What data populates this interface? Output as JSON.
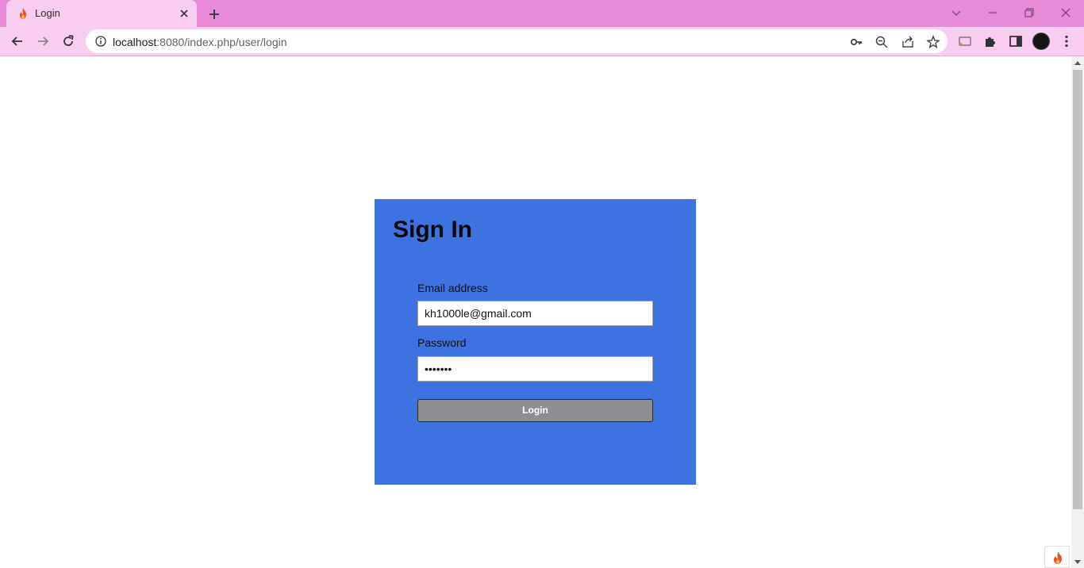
{
  "browser": {
    "tab_title": "Login",
    "url_host": "localhost",
    "url_rest": ":8080/index.php/user/login",
    "accent_color": "#e98ad6"
  },
  "icons": {
    "favicon": "flame-icon",
    "tab_close": "close-icon",
    "new_tab": "plus-icon",
    "back": "arrow-left-icon",
    "forward": "arrow-right-icon",
    "reload": "reload-icon",
    "site_info": "info-icon",
    "key": "key-icon",
    "zoom": "zoom-out-icon",
    "share": "share-icon",
    "bookmark": "star-icon",
    "extensions": "puzzle-icon",
    "side_panel": "side-panel-icon",
    "menu": "kebab-menu-icon"
  },
  "login": {
    "title": "Sign In",
    "email_label": "Email address",
    "email_value": "kh1000le@gmail.com",
    "password_label": "Password",
    "password_value": "•••••••",
    "button_label": "Login",
    "card_color": "#3d72e1",
    "button_color": "#8e8e92"
  }
}
